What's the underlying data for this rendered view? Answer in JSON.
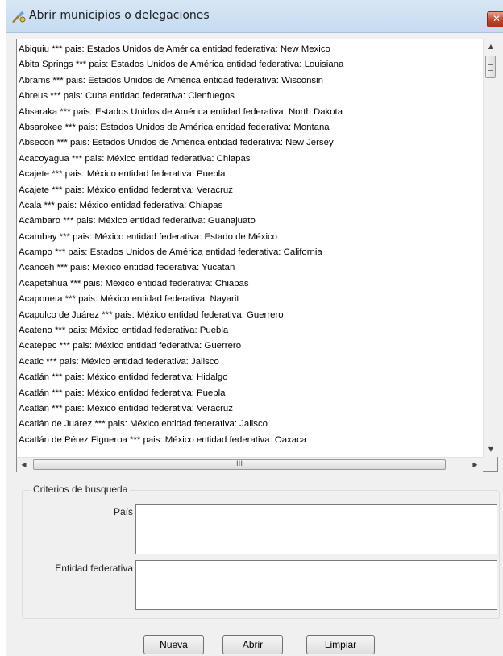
{
  "window": {
    "title": "Abrir municipios o delegaciones",
    "close_label": "✕"
  },
  "list": {
    "items": [
      "Abiquiu *** pais: Estados Unidos de América entidad federativa: New Mexico",
      "Abita Springs *** pais: Estados Unidos de América entidad federativa: Louisiana",
      "Abrams *** pais: Estados Unidos de América entidad federativa: Wisconsin",
      "Abreus *** pais: Cuba entidad federativa: Cienfuegos",
      "Absaraka *** pais: Estados Unidos de América entidad federativa: North Dakota",
      "Absarokee *** pais: Estados Unidos de América entidad federativa: Montana",
      "Absecon *** pais: Estados Unidos de América entidad federativa: New Jersey",
      "Acacoyagua *** pais: México entidad federativa: Chiapas",
      "Acajete *** pais: México entidad federativa: Puebla",
      "Acajete *** pais: México entidad federativa: Veracruz",
      "Acala *** pais: México entidad federativa: Chiapas",
      "Acámbaro *** pais: México entidad federativa: Guanajuato",
      "Acambay *** pais: México entidad federativa: Estado de México",
      "Acampo *** pais: Estados Unidos de América entidad federativa: California",
      "Acanceh *** pais: México entidad federativa: Yucatán",
      "Acapetahua *** pais: México entidad federativa: Chiapas",
      "Acaponeta *** pais: México entidad federativa: Nayarit",
      "Acapulco de Juárez *** pais: México entidad federativa: Guerrero",
      "Acateno *** pais: México entidad federativa: Puebla",
      "Acatepec *** pais: México entidad federativa: Guerrero",
      "Acatic *** pais: México entidad federativa: Jalisco",
      "Acatlán *** pais: México entidad federativa: Hidalgo",
      "Acatlán *** pais: México entidad federativa: Puebla",
      "Acatlán *** pais: México entidad federativa: Veracruz",
      "Acatlán de Juárez *** pais: México entidad federativa: Jalisco",
      "Acatlán de Pérez Figueroa *** pais: México entidad federativa: Oaxaca"
    ],
    "hscroll_thumb_glyph": "III"
  },
  "criteria": {
    "legend": "Criterios de busqueda",
    "pais_label": "País",
    "pais_value": "",
    "entidad_label": "Entidad federativa",
    "entidad_value": ""
  },
  "buttons": {
    "nueva": "Nueva",
    "abrir": "Abrir",
    "limpiar": "Limpiar"
  }
}
